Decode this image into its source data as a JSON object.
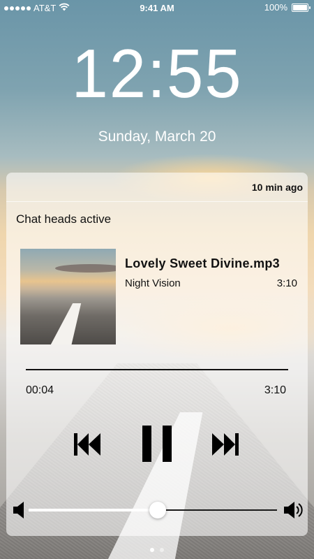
{
  "status_bar": {
    "carrier": "AT&T",
    "time": "9:41 AM",
    "battery_percent": "100%",
    "battery_level": 1.0,
    "icons": [
      "signal-dots-icon",
      "wifi-icon",
      "battery-icon"
    ]
  },
  "lock_screen": {
    "clock": "12:55",
    "date": "Sunday, March 20"
  },
  "notification": {
    "timestamp": "10 min ago",
    "message": "Chat heads active",
    "track": {
      "title": "Lovely Sweet Divine.mp3",
      "artist": "Night Vision",
      "duration": "3:10",
      "elapsed": "00:04",
      "total": "3:10",
      "artwork_icon": "album-artwork-road"
    },
    "controls": {
      "previous_icon": "previous-track-icon",
      "pause_icon": "pause-icon",
      "next_icon": "next-track-icon"
    },
    "volume": {
      "level": 0.52,
      "min_icon": "volume-low-icon",
      "max_icon": "volume-high-icon"
    }
  },
  "page_indicator": {
    "count": 2,
    "active_index": 0
  }
}
